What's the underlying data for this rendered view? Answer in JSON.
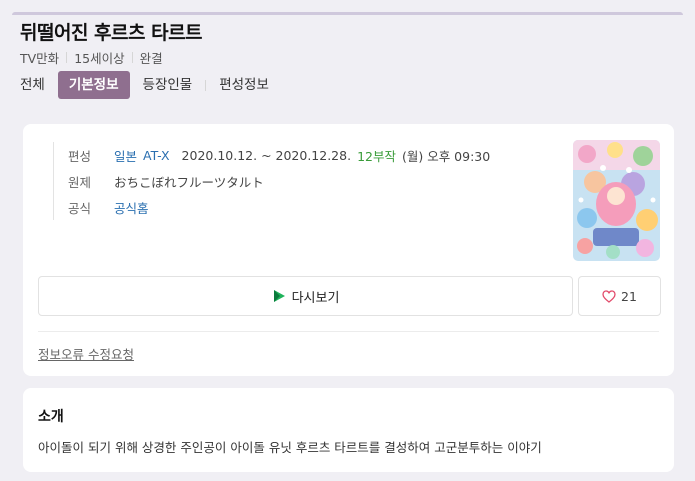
{
  "title": "뒤떨어진 후르츠 타르트",
  "meta": [
    "TV만화",
    "15세이상",
    "완결"
  ],
  "tabs": [
    {
      "label": "전체",
      "active": false
    },
    {
      "label": "기본정보",
      "active": true
    },
    {
      "label": "등장인물",
      "active": false
    },
    {
      "label": "편성정보",
      "active": false
    }
  ],
  "info": {
    "broadcast": {
      "label": "편성",
      "country": "일본",
      "channel": "AT-X",
      "period": "2020.10.12. ~ 2020.12.28.",
      "episodes": "12부작",
      "schedule": "(월) 오후 09:30"
    },
    "original": {
      "label": "원제",
      "value": "おちこぼれフルーツタルト"
    },
    "official": {
      "label": "공식",
      "value": "공식홈"
    }
  },
  "buttons": {
    "rewatch": "다시보기",
    "like_count": "21",
    "report": "정보오류 수정요청"
  },
  "intro": {
    "title": "소개",
    "text": "아이돌이 되기 위해 상경한 주인공이 아이돌 유닛 후르츠 타르트를 결성하여 고군분투하는 이야기"
  },
  "colors": {
    "accent": "#8f6f8f",
    "link": "#2a6fb0",
    "episodes": "#3a9c3a",
    "background": "#f0eff4"
  },
  "icons": {
    "rewatch": "play-logo-icon",
    "like": "heart-icon"
  }
}
